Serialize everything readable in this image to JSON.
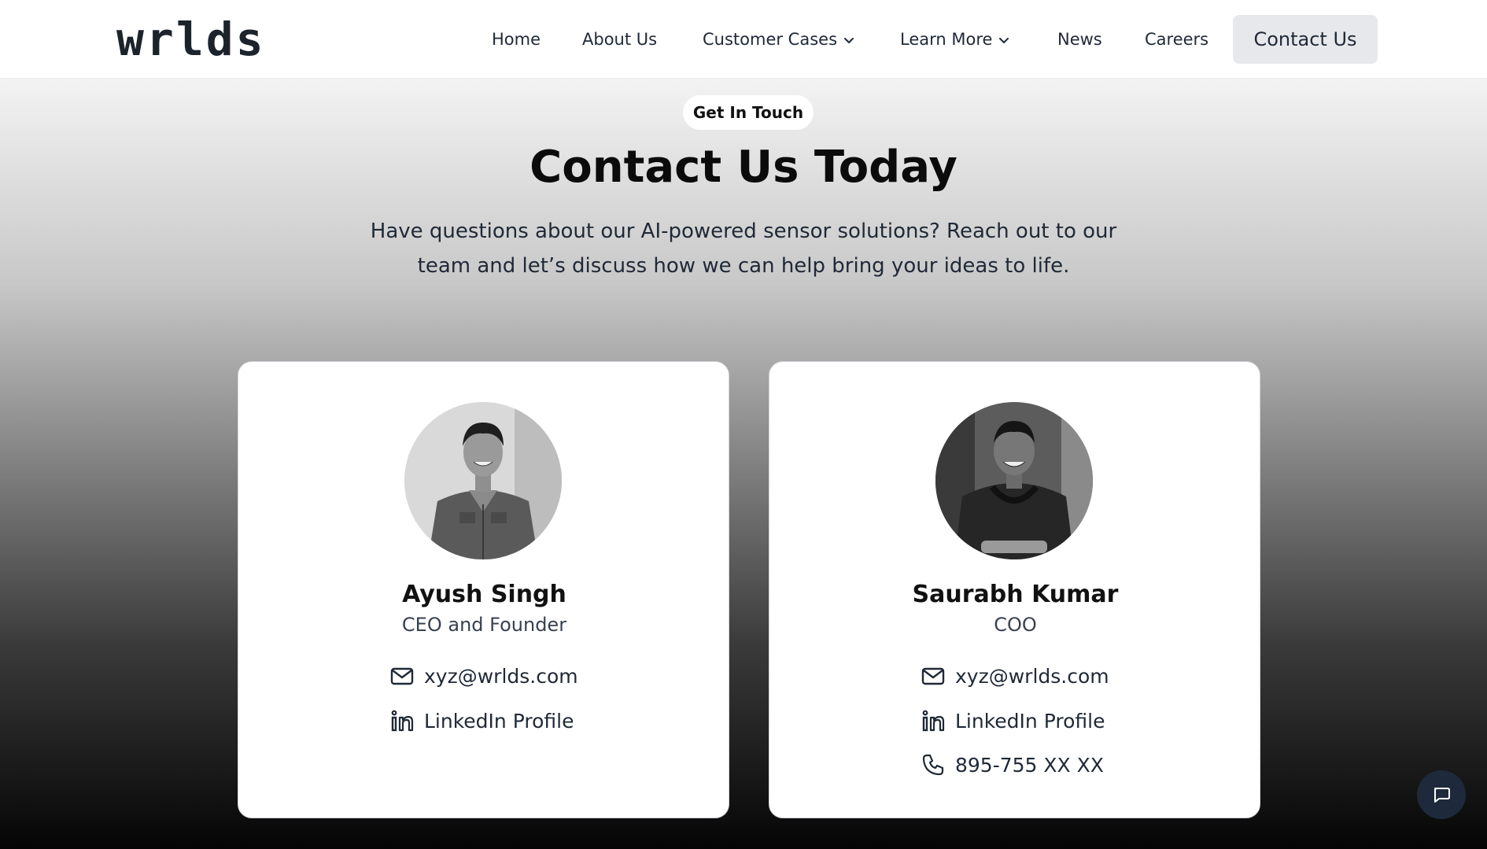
{
  "brand": {
    "logo_text": "wrlds"
  },
  "nav": {
    "items": [
      {
        "label": "Home"
      },
      {
        "label": "About Us"
      },
      {
        "label": "Customer Cases"
      },
      {
        "label": "Learn More"
      },
      {
        "label": "News"
      },
      {
        "label": "Careers"
      }
    ],
    "cta_label": "Contact Us"
  },
  "hero": {
    "pill_label": "Get In Touch",
    "title": "Contact Us Today",
    "subtitle_line1": "Have questions about our AI-powered sensor solutions? Reach out to our",
    "subtitle_line2": "team and let’s discuss how we can help bring your ideas to life."
  },
  "contacts": [
    {
      "name": "Ayush Singh",
      "role": "CEO and Founder",
      "email": "xyz@wrlds.com",
      "linkedin_label": "LinkedIn Profile"
    },
    {
      "name": "Saurabh Kumar",
      "role": "COO",
      "email": "xyz@wrlds.com",
      "linkedin_label": "LinkedIn Profile",
      "phone": "895-755 XX XX"
    }
  ],
  "icons": {
    "mail": "mail-icon",
    "linkedin": "linkedin-icon",
    "phone": "phone-icon",
    "chat": "chat-icon",
    "chevron": "chevron-down-icon"
  },
  "colors": {
    "text_dark": "#111827",
    "cta_background": "#e7e8eb",
    "chat_button": "#1e2a3b"
  }
}
